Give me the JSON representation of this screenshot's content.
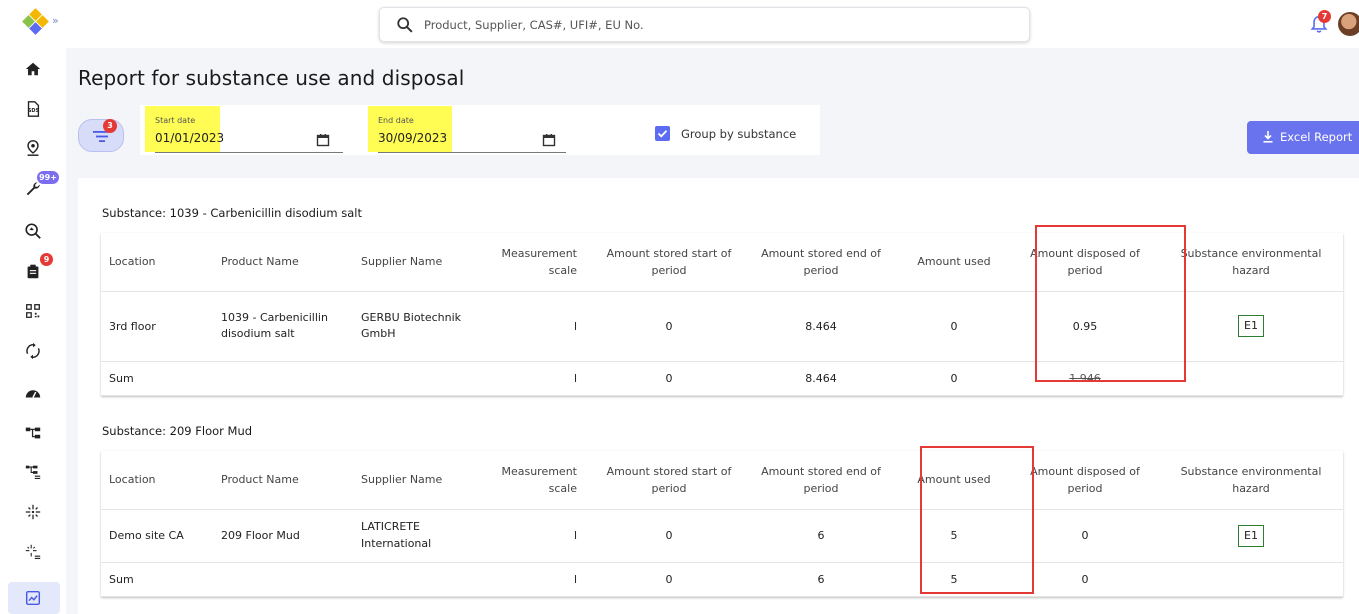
{
  "search": {
    "placeholder": "Product, Supplier, CAS#, UFI#, EU No."
  },
  "notifications": {
    "count": "7"
  },
  "sidebar": {
    "badges": {
      "tools": "99+",
      "inventory": "9"
    },
    "items": [
      "home-icon",
      "sds-icon",
      "location-icon",
      "tools-icon",
      "search-hazard-icon",
      "inventory-icon",
      "qr-icon",
      "sync-icon",
      "dashboard-icon",
      "tree-icon",
      "tree-list-icon",
      "sparkle-icon",
      "sparkle-list-icon",
      "report-icon"
    ]
  },
  "page": {
    "title": "Report for substance use and disposal"
  },
  "filters": {
    "active_count": "3",
    "start_date": {
      "label": "Start date",
      "value": "01/01/2023"
    },
    "end_date": {
      "label": "End date",
      "value": "30/09/2023"
    },
    "group_by_substance": {
      "label": "Group by substance",
      "checked": true
    },
    "excel_button": "Excel Report"
  },
  "columns": [
    "Location",
    "Product Name",
    "Supplier Name",
    "Measurement scale",
    "Amount stored start of period",
    "Amount stored end of period",
    "Amount used",
    "Amount disposed of period",
    "Substance environmental hazard"
  ],
  "sections": [
    {
      "title": "Substance: 1039 - Carbenicillin disodium salt",
      "rows": [
        {
          "location": "3rd floor",
          "product": "1039 - Carbenicillin disodium salt",
          "supplier": "GERBU Biotechnik GmbH",
          "scale": "l",
          "start": "0",
          "end": "8.464",
          "used": "0",
          "disposed": "0.95",
          "hazard": "E1"
        }
      ],
      "sum": {
        "label": "Sum",
        "scale": "l",
        "start": "0",
        "end": "8.464",
        "used": "0",
        "disposed": "1.946"
      }
    },
    {
      "title": "Substance: 209 Floor Mud",
      "rows": [
        {
          "location": "Demo site CA",
          "product": "209 Floor Mud",
          "supplier": "LATICRETE International",
          "scale": "l",
          "start": "0",
          "end": "6",
          "used": "5",
          "disposed": "0",
          "hazard": "E1"
        }
      ],
      "sum": {
        "label": "Sum",
        "scale": "l",
        "start": "0",
        "end": "6",
        "used": "5",
        "disposed": "0"
      }
    }
  ]
}
